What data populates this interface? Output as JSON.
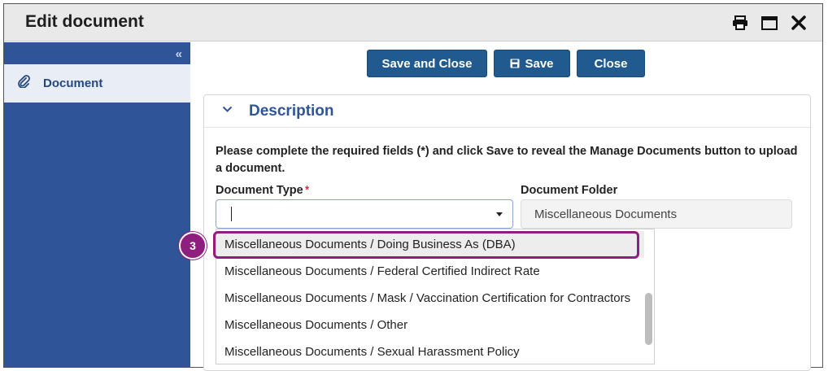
{
  "window": {
    "title": "Edit document",
    "icons": [
      "printer-icon",
      "maximize-icon",
      "close-icon"
    ]
  },
  "sidebar": {
    "collapse_label": "«",
    "items": [
      {
        "label": "Document",
        "icon": "paperclip-icon"
      }
    ]
  },
  "toolbar": {
    "save_close_label": "Save and Close",
    "save_label": "Save",
    "save_icon": "floppy-disk-icon",
    "close_label": "Close"
  },
  "section": {
    "title": "Description",
    "instructions": "Please complete the required fields (*) and click Save to reveal the Manage Documents button to upload a document."
  },
  "form": {
    "document_type": {
      "label": "Document Type",
      "required_marker": "*",
      "value": ""
    },
    "document_folder": {
      "label": "Document Folder",
      "value": "Miscellaneous Documents"
    }
  },
  "dropdown": {
    "options": [
      "Miscellaneous Documents / Doing Business As (DBA)",
      "Miscellaneous Documents / Federal Certified Indirect Rate",
      "Miscellaneous Documents / Mask / Vaccination Certification for Contractors",
      "Miscellaneous Documents / Other",
      "Miscellaneous Documents / Sexual Harassment Policy"
    ],
    "highlighted_index": 0
  },
  "annotation": {
    "step_number": "3"
  },
  "colors": {
    "sidebar": "#2f5498",
    "button": "#205a8e",
    "accent_title": "#2f5498",
    "highlight": "#8e1f7e",
    "required": "#d0021b"
  }
}
